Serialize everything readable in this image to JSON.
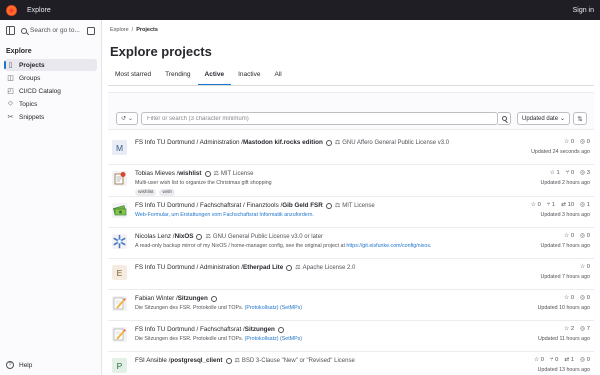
{
  "topbar": {
    "brand": "Explore",
    "signin": "Sign in"
  },
  "sidebar": {
    "search_label": "Search or go to...",
    "section_title": "Explore",
    "items": [
      {
        "label": "Projects",
        "icon": "project-icon"
      },
      {
        "label": "Groups",
        "icon": "group-icon"
      },
      {
        "label": "CI/CD Catalog",
        "icon": "catalog-icon"
      },
      {
        "label": "Topics",
        "icon": "label-icon"
      },
      {
        "label": "Snippets",
        "icon": "snippet-icon"
      }
    ],
    "help": "Help"
  },
  "breadcrumb": {
    "root": "Explore",
    "current": "Projects"
  },
  "page_title": "Explore projects",
  "tabs": [
    "Most starred",
    "Trending",
    "Active",
    "Inactive",
    "All"
  ],
  "filter": {
    "placeholder": "Filter or search (3 character minimum)",
    "sort": "Updated date"
  },
  "projects": [
    {
      "avatar": "M",
      "path": "FS Info TU Dortmund / Administration / ",
      "name": "Mastodon kif.rocks edition",
      "license": "GNU Affero General Public License v3.0",
      "description": "",
      "links": [],
      "tags": [],
      "stars": "0",
      "forks": "",
      "mrs": "",
      "issues": "0",
      "updated": "Updated 24 seconds ago"
    },
    {
      "avatar": "",
      "path": "Tobias Mieves / ",
      "name": "wishlist",
      "license": "MIT License",
      "description": "Multi-user wish list to organize the Christmas gift shopping",
      "links": [],
      "tags": [
        "wishlist",
        "wish"
      ],
      "stars": "1",
      "forks": "",
      "mrs": "0",
      "issues": "3",
      "updated": "Updated 2 hours ago"
    },
    {
      "avatar": "",
      "path": "FS Info TU Dortmund / Fachschaftsrat / Finanztools / ",
      "name": "Gib Geld FSR",
      "license": "MIT License",
      "description": "Web-Formular, um Erstattungen vom Fachschaftsrat Informatik anzufordern.",
      "links": [],
      "tags": [],
      "stars": "0",
      "forks": "1",
      "mrs": "10",
      "issues": "1",
      "updated": "Updated 3 hours ago"
    },
    {
      "avatar": "",
      "path": "Nicolas Lenz / ",
      "name": "NixOS",
      "license": "GNU General Public License v3.0 or later",
      "description": "A read-only backup mirror of my NixOS / home-manager config, see the original project at ",
      "links": [
        "https://git.eisfunke.com/config/nixos."
      ],
      "tags": [],
      "stars": "0",
      "forks": "",
      "mrs": "",
      "issues": "0",
      "updated": "Updated 7 hours ago"
    },
    {
      "avatar": "E",
      "path": "FS Info TU Dortmund / Administration / ",
      "name": "Etherpad Lite",
      "license": "Apache License 2.0",
      "description": "",
      "links": [],
      "tags": [],
      "stars": "0",
      "forks": "",
      "mrs": "",
      "issues": "",
      "updated": "Updated 7 hours ago"
    },
    {
      "avatar": "",
      "path": "Fabian Winter / ",
      "name": "Sitzungen",
      "license": "",
      "description": "Die Sitzungen des FSR. Protokolle und TOPs. ",
      "links": [
        "(Protokollsatz)",
        "(SetMPs)"
      ],
      "tags": [],
      "stars": "0",
      "forks": "",
      "mrs": "",
      "issues": "0",
      "updated": "Updated 10 hours ago"
    },
    {
      "avatar": "",
      "path": "FS Info TU Dortmund / Fachschaftsrat / ",
      "name": "Sitzungen",
      "license": "",
      "description": "Die Sitzungen des FSR. Protokolle und TOPs. ",
      "links": [
        "(Protokollsatz)",
        "(SetMPs)"
      ],
      "tags": [],
      "stars": "2",
      "forks": "",
      "mrs": "",
      "issues": "7",
      "updated": "Updated 11 hours ago"
    },
    {
      "avatar": "P",
      "path": "FSI Ansible / ",
      "name": "postgresql_client",
      "license": "BSD 3-Clause \"New\" or \"Revised\" License",
      "description": "",
      "links": [],
      "tags": [],
      "stars": "0",
      "forks": "0",
      "mrs": "1",
      "issues": "0",
      "updated": "Updated 13 hours ago"
    }
  ],
  "colors": {
    "topbar": "#1f1e24",
    "accent": "#1f75cb",
    "sidebar": "#fbfafd"
  }
}
